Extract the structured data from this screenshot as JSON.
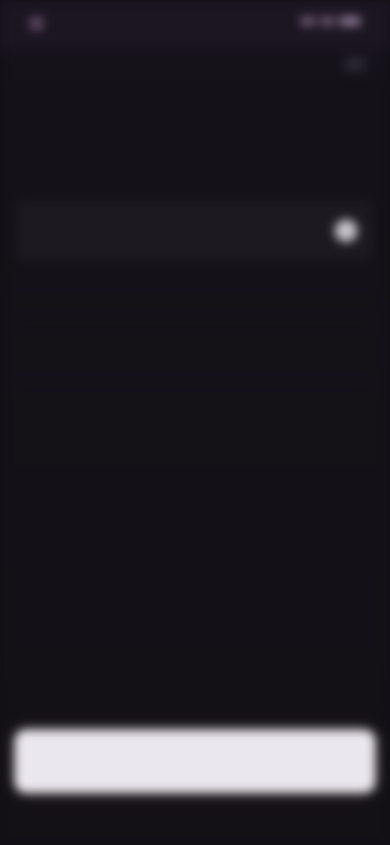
{
  "screen": {
    "title": "",
    "subtitle": ""
  },
  "options": [
    {
      "label": "",
      "selected": true
    },
    {
      "label": "",
      "selected": false
    },
    {
      "label": "",
      "selected": false
    }
  ],
  "cta": {
    "label": ""
  },
  "colors": {
    "background": "#121016",
    "status_bar": "#1c1522",
    "cta_background": "#ebe7ee"
  }
}
